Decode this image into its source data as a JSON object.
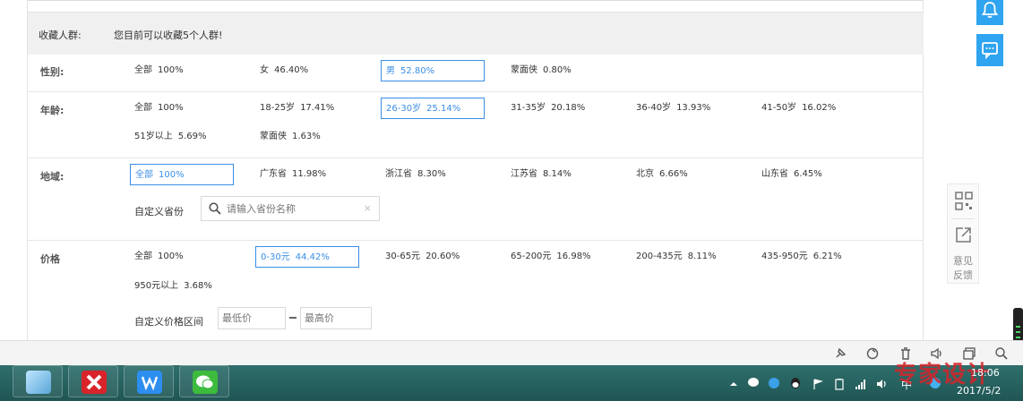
{
  "favorites": {
    "title": "收藏人群:",
    "text": "您目前可以收藏5个人群!"
  },
  "gender": {
    "label": "性别:",
    "options": [
      {
        "name": "全部",
        "pct": "100%"
      },
      {
        "name": "女",
        "pct": "46.40%"
      },
      {
        "name": "男",
        "pct": "52.80%"
      },
      {
        "name": "蒙面侠",
        "pct": "0.80%"
      }
    ],
    "selected": "男"
  },
  "age": {
    "label": "年龄:",
    "options": [
      {
        "name": "全部",
        "pct": "100%"
      },
      {
        "name": "18-25岁",
        "pct": "17.41%"
      },
      {
        "name": "26-30岁",
        "pct": "25.14%"
      },
      {
        "name": "31-35岁",
        "pct": "20.18%"
      },
      {
        "name": "36-40岁",
        "pct": "13.93%"
      },
      {
        "name": "41-50岁",
        "pct": "16.02%"
      },
      {
        "name": "51岁以上",
        "pct": "5.69%"
      },
      {
        "name": "蒙面侠",
        "pct": "1.63%"
      }
    ],
    "selected": "26-30岁"
  },
  "region": {
    "label": "地域:",
    "options": [
      {
        "name": "全部",
        "pct": "100%"
      },
      {
        "name": "广东省",
        "pct": "11.98%"
      },
      {
        "name": "浙江省",
        "pct": "8.30%"
      },
      {
        "name": "江苏省",
        "pct": "8.14%"
      },
      {
        "name": "北京",
        "pct": "6.66%"
      },
      {
        "name": "山东省",
        "pct": "6.45%"
      }
    ],
    "selected": "全部",
    "custom_label": "自定义省份",
    "search_placeholder": "请输入省份名称",
    "clear_glyph": "×"
  },
  "price": {
    "label": "价格",
    "options": [
      {
        "name": "全部",
        "pct": "100%"
      },
      {
        "name": "0-30元",
        "pct": "44.42%"
      },
      {
        "name": "30-65元",
        "pct": "20.60%"
      },
      {
        "name": "65-200元",
        "pct": "16.98%"
      },
      {
        "name": "200-435元",
        "pct": "8.11%"
      },
      {
        "name": "435-950元",
        "pct": "6.21%"
      },
      {
        "name": "950元以上",
        "pct": "3.68%"
      }
    ],
    "selected": "0-30元",
    "custom_label": "自定义价格区间",
    "min_placeholder": "最低价",
    "max_placeholder": "最高价"
  },
  "side": {
    "feedback_line1": "意见",
    "feedback_line2": "反馈",
    "accent": "#2fa4f0"
  },
  "taskbar": {
    "time": "18:06",
    "date": "2017/5/2",
    "ime": "中",
    "watermark": "专家设计"
  },
  "colors": {
    "selected_border": "#3a8ee6",
    "taskbar": "#2f6f6c"
  }
}
